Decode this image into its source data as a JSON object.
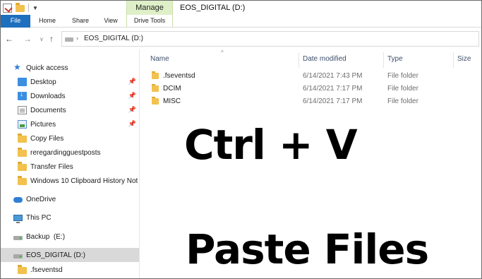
{
  "window": {
    "title": "EOS_DIGITAL (D:)",
    "contextual_tab_group": "Manage"
  },
  "ribbon": {
    "tabs": [
      "File",
      "Home",
      "Share",
      "View",
      "Drive Tools"
    ]
  },
  "address": {
    "path": "EOS_DIGITAL (D:)"
  },
  "nav": {
    "quick_access": "Quick access",
    "items": [
      {
        "label": "Desktop",
        "icon": "desktop-icon",
        "pinned": true
      },
      {
        "label": "Downloads",
        "icon": "downloads-icon",
        "pinned": true
      },
      {
        "label": "Documents",
        "icon": "documents-icon",
        "pinned": true
      },
      {
        "label": "Pictures",
        "icon": "pictures-icon",
        "pinned": true
      },
      {
        "label": "Copy Files",
        "icon": "folder-icon",
        "pinned": false
      },
      {
        "label": "reregardingguestposts",
        "icon": "folder-icon",
        "pinned": false
      },
      {
        "label": "Transfer Files",
        "icon": "folder-icon",
        "pinned": false
      },
      {
        "label": "Windows 10 Clipboard History Not",
        "icon": "folder-icon",
        "pinned": false
      }
    ],
    "onedrive": "OneDrive",
    "this_pc": "This PC",
    "backup": "Backup  (E:)",
    "eos": "EOS_DIGITAL (D:)",
    "fseventsd": ".fseventsd"
  },
  "columns": {
    "name": "Name",
    "date": "Date modified",
    "type": "Type",
    "size": "Size"
  },
  "files": [
    {
      "name": ".fseventsd",
      "date": "6/14/2021 7:43 PM",
      "type": "File folder"
    },
    {
      "name": "DCIM",
      "date": "6/14/2021 7:17 PM",
      "type": "File folder"
    },
    {
      "name": "MISC",
      "date": "6/14/2021 7:17 PM",
      "type": "File folder"
    }
  ],
  "overlay": {
    "shortcut": "Ctrl + V",
    "action": "Paste Files"
  },
  "colors": {
    "file_tab": "#1e6fbd",
    "manage_tab": "#dff0c8",
    "selected_nav": "#d9d9d9",
    "folder": "#f2c14e"
  }
}
